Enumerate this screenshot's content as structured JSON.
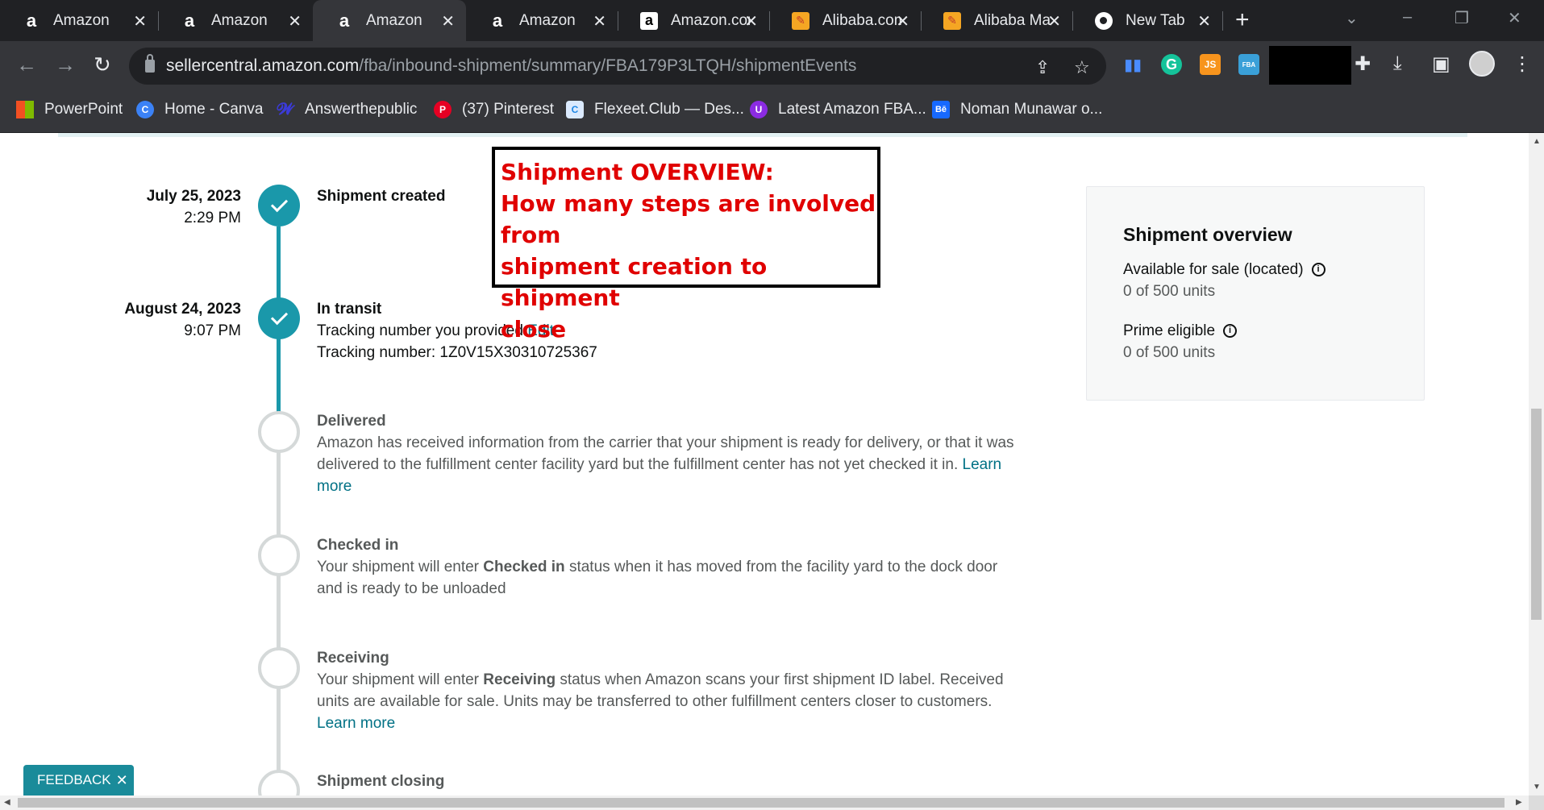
{
  "browser": {
    "tabs": [
      {
        "favicon": "amazon-icon",
        "title": "Amazon",
        "active": false
      },
      {
        "favicon": "amazon-icon",
        "title": "Amazon",
        "active": false
      },
      {
        "favicon": "amazon-icon",
        "title": "Amazon",
        "active": true
      },
      {
        "favicon": "amazon-icon",
        "title": "Amazon",
        "active": false
      },
      {
        "favicon": "amazon-boxed-icon",
        "title": "Amazon.com",
        "active": false
      },
      {
        "favicon": "alibaba-icon",
        "title": "Alibaba.com",
        "active": false
      },
      {
        "favicon": "alibaba-icon",
        "title": "Alibaba Ma",
        "active": false
      },
      {
        "favicon": "chrome-icon",
        "title": "New Tab",
        "active": false
      }
    ],
    "new_tab": "+",
    "url_host": "sellercentral.amazon.com",
    "url_path": "/fba/inbound-shipment/summary/FBA179P3LTQH/shipmentEvents",
    "bookmarks": [
      {
        "icon": "microsoft-icon",
        "label": "PowerPoint"
      },
      {
        "icon": "canva-icon",
        "label": "Home - Canva"
      },
      {
        "icon": "answerthepublic-icon",
        "label": "Answerthepublic"
      },
      {
        "icon": "pinterest-icon",
        "label": "(37) Pinterest"
      },
      {
        "icon": "flexeet-icon",
        "label": "Flexeet.Club — Des..."
      },
      {
        "icon": "latest-amazon-icon",
        "label": "Latest Amazon FBA..."
      },
      {
        "icon": "behance-icon",
        "label": "Noman Munawar o..."
      }
    ],
    "extensions": {
      "js": "JS",
      "fba": "FBA",
      "grammarly": "G"
    }
  },
  "timeline": [
    {
      "date": "July 25, 2023",
      "time": "2:29 PM",
      "title": "Shipment created",
      "status": "done"
    },
    {
      "date": "August 24, 2023",
      "time": "9:07 PM",
      "title": "In transit",
      "status": "done",
      "lines": {
        "provided": "Tracking number you provided",
        "edit": "Edit",
        "tracking": "Tracking number: 1Z0V15X30310725367"
      }
    },
    {
      "title": "Delivered",
      "status": "todo",
      "text": "Amazon has received information from the carrier that your shipment is ready for delivery, or that it was delivered to the fulfillment center facility yard but the fulfillment center has not yet checked it in.",
      "link": "Learn more"
    },
    {
      "title": "Checked in",
      "status": "todo",
      "pre": "Your shipment will enter ",
      "bold": "Checked in",
      "post": " status when it has moved from the facility yard to the dock door and is ready to be unloaded"
    },
    {
      "title": "Receiving",
      "status": "todo",
      "pre": "Your shipment will enter ",
      "bold": "Receiving",
      "post": " status when Amazon scans your first shipment ID label. Received units are available for sale. Units may be transferred to other fulfillment centers closer to customers.",
      "link": "Learn more"
    },
    {
      "title": "Shipment closing",
      "status": "todo"
    }
  ],
  "annotation": {
    "line1": "Shipment OVERVIEW:",
    "line2": "How many steps are involved from",
    "line3": "shipment creation to shipment",
    "line4": "close"
  },
  "overview": {
    "heading": "Shipment overview",
    "rows": [
      {
        "label": "Available for sale (located)",
        "value": "0 of 500 units"
      },
      {
        "label": "Prime eligible",
        "value": "0 of 500 units"
      }
    ]
  },
  "feedback": {
    "label": "FEEDBACK",
    "close": "✕"
  },
  "colors": {
    "accent": "#1a98aa",
    "link": "#007185",
    "annotation": "#e00000"
  }
}
